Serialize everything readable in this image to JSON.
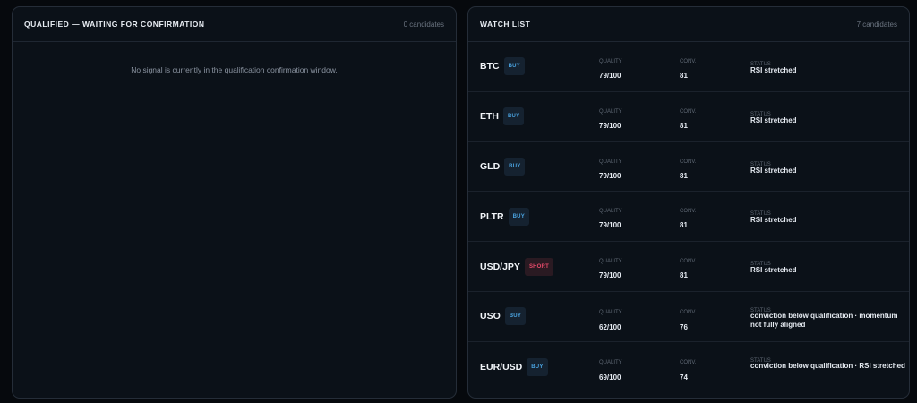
{
  "qualified": {
    "title": "QUALIFIED — WAITING FOR CONFIRMATION",
    "count": "0 candidates",
    "empty_message": "No signal is currently in the qualification confirmation window."
  },
  "watchlist": {
    "title": "WATCH LIST",
    "count": "7 candidates",
    "labels": {
      "quality": "QUALITY",
      "conv": "CONV.",
      "status": "STATUS"
    },
    "rows": [
      {
        "ticker": "BTC",
        "side": "BUY",
        "quality": "79/100",
        "conv": "81",
        "status": "RSI stretched"
      },
      {
        "ticker": "ETH",
        "side": "BUY",
        "quality": "79/100",
        "conv": "81",
        "status": "RSI stretched"
      },
      {
        "ticker": "GLD",
        "side": "BUY",
        "quality": "79/100",
        "conv": "81",
        "status": "RSI stretched"
      },
      {
        "ticker": "PLTR",
        "side": "BUY",
        "quality": "79/100",
        "conv": "81",
        "status": "RSI stretched"
      },
      {
        "ticker": "USD/JPY",
        "side": "SHORT",
        "quality": "79/100",
        "conv": "81",
        "status": "RSI stretched"
      },
      {
        "ticker": "USO",
        "side": "BUY",
        "quality": "62/100",
        "conv": "76",
        "status": "conviction below qualification · momentum not fully aligned"
      },
      {
        "ticker": "EUR/USD",
        "side": "BUY",
        "quality": "69/100",
        "conv": "74",
        "status": "conviction below qualification · RSI stretched"
      }
    ]
  },
  "colors": {
    "buy": "#4aa3e0",
    "short": "#e84a6a",
    "panel_bg": "#0b1118",
    "page_bg": "#06090d"
  }
}
